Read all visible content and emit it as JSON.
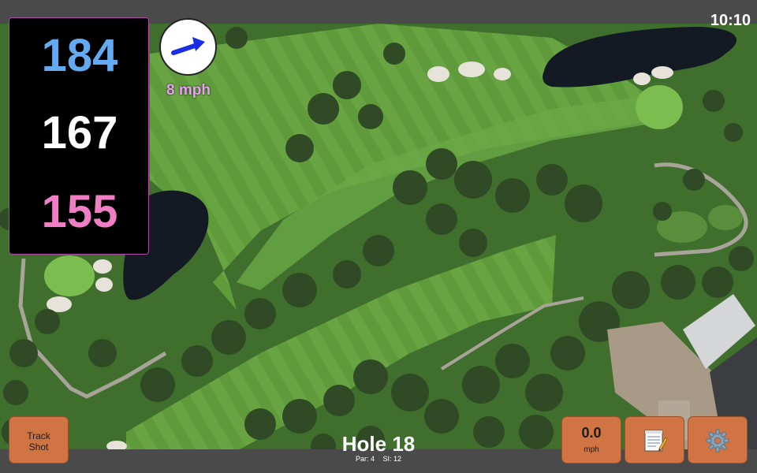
{
  "status_bar": {
    "time": "10:10"
  },
  "distances": {
    "back": "184",
    "middle": "167",
    "front": "155"
  },
  "wind": {
    "speed_label": "8 mph",
    "arrow_color": "#1a2de6"
  },
  "buttons": {
    "track_shot_line1": "Track",
    "track_shot_line2": "Shot",
    "speed_value": "0.0",
    "speed_unit": "mph",
    "scorecard_icon": "scorecard-icon",
    "settings_icon": "gear-icon"
  },
  "hole": {
    "title": "Hole 18",
    "par_label": "Par: 4",
    "si_label": "SI: 12"
  },
  "colors": {
    "back_distance": "#63aaf2",
    "middle_distance": "#ffffff",
    "front_distance": "#f07ec5",
    "button": "#cf7442",
    "wind_label": "#e7a2f2"
  }
}
